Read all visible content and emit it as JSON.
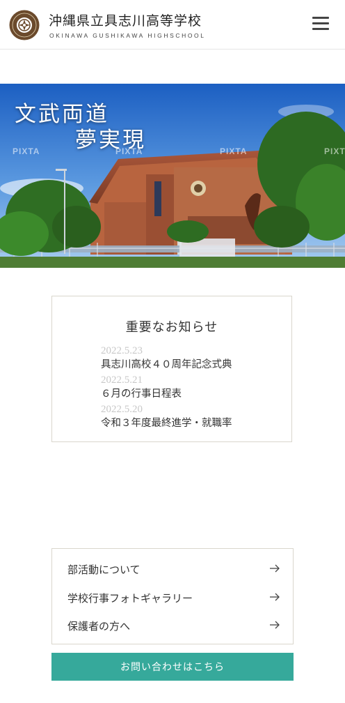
{
  "header": {
    "school_name": "沖縄県立具志川高等学校",
    "school_name_roman": "OKINAWA GUSHIKAWA HIGHSCHOOL"
  },
  "hero": {
    "line1": "文武両道",
    "line2": "夢実現",
    "watermark": "PIXTA"
  },
  "notices": {
    "title": "重要なお知らせ",
    "items": [
      {
        "date": "2022.5.23",
        "title": "具志川高校４０周年記念式典"
      },
      {
        "date": "2022.5.21",
        "title": "６月の行事日程表"
      },
      {
        "date": "2022.5.20",
        "title": "令和３年度最終進学・就職率"
      }
    ]
  },
  "links": [
    {
      "label": "部活動について",
      "icon": "arrow-right-icon"
    },
    {
      "label": "学校行事フォトギャラリー",
      "icon": "arrow-right-icon"
    },
    {
      "label": "保護者の方へ",
      "icon": "arrow-right-icon"
    }
  ],
  "contact_button": "お問い合わせはこちら",
  "colors": {
    "accent": "#36a99b",
    "border": "#d9d6cc",
    "date_text": "#c8c8c8"
  }
}
